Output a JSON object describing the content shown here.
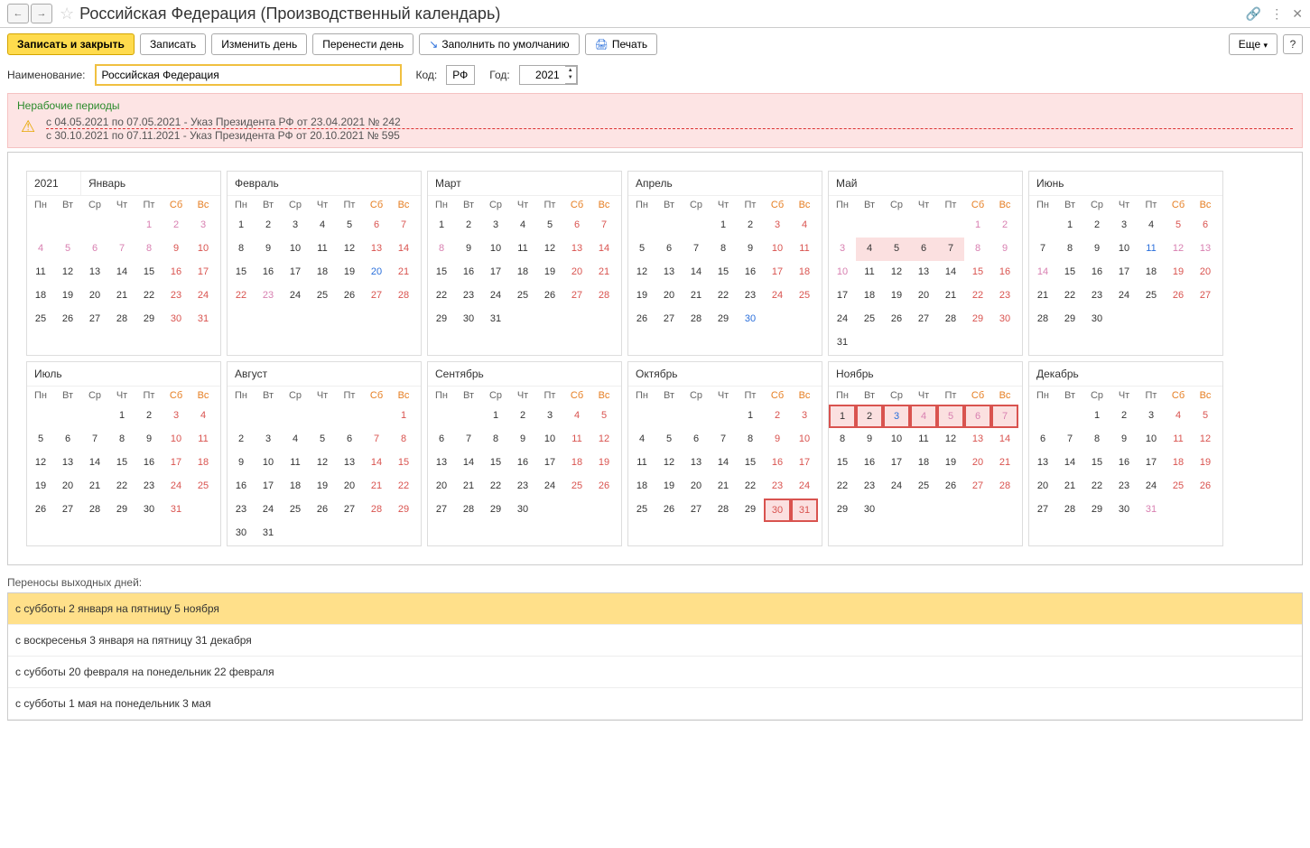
{
  "title": "Российская Федерация (Производственный календарь)",
  "toolbar": {
    "save_close": "Записать и закрыть",
    "save": "Записать",
    "change_day": "Изменить день",
    "move_day": "Перенести день",
    "fill_default": "Заполнить по умолчанию",
    "print": "Печать",
    "more": "Еще"
  },
  "fields": {
    "name_label": "Наименование:",
    "name_value": "Российская Федерация",
    "code_label": "Код:",
    "code_value": "РФ",
    "year_label": "Год:",
    "year_value": "2021"
  },
  "warning": {
    "heading": "Нерабочие периоды",
    "line1": "с 04.05.2021 по 07.05.2021 - Указ Президента РФ от 23.04.2021 № 242",
    "line2": "с 30.10.2021 по 07.11.2021 - Указ Президента РФ от 20.10.2021 № 595"
  },
  "year_display": "2021",
  "dow": [
    "Пн",
    "Вт",
    "Ср",
    "Чт",
    "Пт",
    "Сб",
    "Вс"
  ],
  "months": [
    {
      "name": "Январь",
      "start": 4,
      "days": 31,
      "hol": [
        1,
        2,
        3,
        4,
        5,
        6,
        7,
        8
      ],
      "wknd": [
        9,
        10,
        16,
        17,
        23,
        24,
        30,
        31
      ],
      "spec": []
    },
    {
      "name": "Февраль",
      "start": 0,
      "days": 28,
      "hol": [
        23
      ],
      "wknd": [
        6,
        7,
        13,
        14,
        20,
        21,
        22,
        27,
        28
      ],
      "spec": [
        20
      ]
    },
    {
      "name": "Март",
      "start": 0,
      "days": 31,
      "hol": [
        8
      ],
      "wknd": [
        6,
        7,
        13,
        14,
        20,
        21,
        27,
        28
      ],
      "spec": []
    },
    {
      "name": "Апрель",
      "start": 3,
      "days": 30,
      "hol": [],
      "wknd": [
        3,
        4,
        10,
        11,
        17,
        18,
        24,
        25
      ],
      "spec": [
        30
      ]
    },
    {
      "name": "Май",
      "start": 5,
      "days": 31,
      "hol": [
        1,
        2,
        3,
        8,
        9,
        10
      ],
      "wknd": [
        15,
        16,
        22,
        23,
        29,
        30
      ],
      "spec": [],
      "nw": [
        4,
        5,
        6,
        7
      ]
    },
    {
      "name": "Июнь",
      "start": 1,
      "days": 30,
      "hol": [
        12,
        13,
        14
      ],
      "wknd": [
        5,
        6,
        19,
        20,
        26,
        27
      ],
      "spec": [
        11
      ]
    },
    {
      "name": "Июль",
      "start": 3,
      "days": 31,
      "hol": [],
      "wknd": [
        3,
        4,
        10,
        11,
        17,
        18,
        24,
        25,
        31
      ],
      "spec": []
    },
    {
      "name": "Август",
      "start": 6,
      "days": 31,
      "hol": [],
      "wknd": [
        1,
        7,
        8,
        14,
        15,
        21,
        22,
        28,
        29
      ],
      "spec": []
    },
    {
      "name": "Сентябрь",
      "start": 2,
      "days": 30,
      "hol": [],
      "wknd": [
        4,
        5,
        11,
        12,
        18,
        19,
        25,
        26
      ],
      "spec": []
    },
    {
      "name": "Октябрь",
      "start": 4,
      "days": 31,
      "hol": [],
      "wknd": [
        2,
        3,
        9,
        10,
        16,
        17,
        23,
        24
      ],
      "spec": [],
      "nwbox": [
        30,
        31
      ]
    },
    {
      "name": "Ноябрь",
      "start": 0,
      "days": 30,
      "hol": [
        4,
        5,
        6,
        7
      ],
      "wknd": [
        13,
        14,
        20,
        21,
        27,
        28
      ],
      "spec": [
        3
      ],
      "nwbox": [
        1,
        2,
        3,
        4,
        5,
        6,
        7
      ]
    },
    {
      "name": "Декабрь",
      "start": 2,
      "days": 31,
      "hol": [
        31
      ],
      "wknd": [
        4,
        5,
        11,
        12,
        18,
        19,
        25,
        26
      ],
      "spec": []
    }
  ],
  "transfers": {
    "heading": "Переносы выходных дней:",
    "rows": [
      "с субботы 2 января на пятницу 5 ноября",
      "с воскресенья 3 января на пятницу 31 декабря",
      "с субботы 20 февраля на понедельник 22 февраля",
      "с субботы 1 мая на понедельник 3 мая"
    ]
  }
}
